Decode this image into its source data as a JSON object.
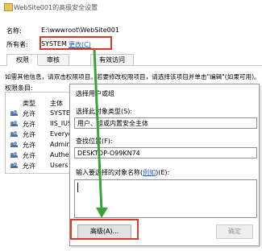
{
  "window": {
    "title": "WebSite001的高级安全设置",
    "name_label": "名称:",
    "name_value": "E:\\wwwroot\\WebSite001",
    "owner_label": "所有者:",
    "owner_value": "SYSTEM",
    "owner_change_link": "更改(C)",
    "tabs": [
      "权限",
      "审核",
      "有效访问"
    ],
    "info_text": "如需其他信息，请双击权限项目。若要修改权限项目，请选择该项目并单击\"编辑\"(如果可用)。",
    "entries_label": "权限条目:",
    "columns": {
      "type": "类型",
      "principal": "主体"
    },
    "entries": [
      {
        "type": "允许",
        "principal": "SYSTE"
      },
      {
        "type": "允许",
        "principal": "IIS_IUS"
      },
      {
        "type": "允许",
        "principal": "Everyo"
      },
      {
        "type": "允许",
        "principal": "Admin"
      },
      {
        "type": "允许",
        "principal": "Authen"
      },
      {
        "type": "允许",
        "principal": "Users ("
      }
    ]
  },
  "dialog": {
    "title": "选择用户或组",
    "object_type_label": "选择此对象类型(S):",
    "object_type_value": "用户、组或内置安全主体",
    "location_label": "查找位置(F):",
    "location_value": "DESKTOP-O99KN74",
    "enter_label_prefix": "输入要选择的对象名称(",
    "enter_label_link": "例如",
    "enter_label_suffix": ")(E):",
    "advanced_button": "高级(A)...",
    "ok_button": "确定"
  },
  "colors": {
    "highlight_box": "#d93b2b",
    "arrow": "#3aa23a",
    "link": "#1a63c9"
  }
}
